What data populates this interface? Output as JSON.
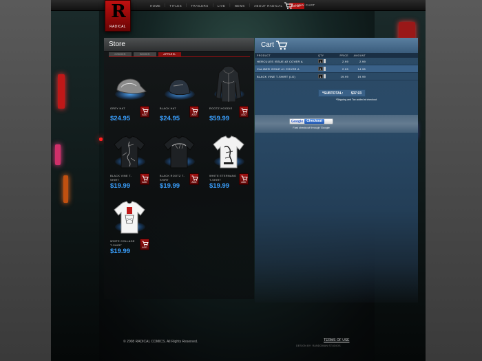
{
  "brand": {
    "logo_text": "RADICAL"
  },
  "nav": {
    "items": [
      "HOME",
      "TITLES",
      "TRAILERS",
      "LIVE",
      "NEWS",
      "ABOUT RADICAL"
    ],
    "active": "SHOP",
    "cart_link": "VIEW CART"
  },
  "store": {
    "title": "Store",
    "tabs": [
      "COMICS",
      "BOOKS",
      "APPAREL"
    ],
    "active_tab": "APPAREL",
    "products": [
      {
        "name": "GREY HAT",
        "price": "$24.95",
        "add_label": "ADD",
        "icon": "hat-icon"
      },
      {
        "name": "BLACK HAT",
        "price": "$24.95",
        "add_label": "ADD",
        "icon": "hat-icon"
      },
      {
        "name": "ROOTZ HOODIE",
        "price": "$59.99",
        "add_label": "ADD",
        "icon": "hoodie-icon"
      },
      {
        "name": "BLACK VINE T-SHIRT",
        "price": "$19.99",
        "add_label": "ADD",
        "icon": "tshirt-icon"
      },
      {
        "name": "BLACK ROOTZ T-SHIRT",
        "price": "$19.99",
        "add_label": "ADD",
        "icon": "tshirt-icon"
      },
      {
        "name": "WHITE ETERNANO T-SHIRT",
        "price": "$19.99",
        "add_label": "ADD",
        "icon": "tshirt-icon"
      },
      {
        "name": "WHITE COLLAGE T-SHIRT",
        "price": "$19.99",
        "add_label": "ADD",
        "icon": "tshirt-icon"
      }
    ]
  },
  "cart": {
    "title": "Cart",
    "columns": {
      "product": "PRODUCT",
      "qty": "QTY",
      "price": "PRICE",
      "amount": "AMOUNT"
    },
    "rows": [
      {
        "product": "HERCULES ISSUE #2 COVER A",
        "qty": "1",
        "price": "2.99",
        "amount": "2.99"
      },
      {
        "product": "CALIBER ISSUE #1 COVER A",
        "qty": "5",
        "price": "2.99",
        "amount": "14.95"
      },
      {
        "product": "BLACK VINE T-SHIRT (LG)",
        "qty": "1",
        "price": "19.99",
        "amount": "19.99"
      }
    ],
    "subtotal_label": "*SUBTOTAL:",
    "subtotal_value": "$37.93",
    "shipping_note": "*Shipping and Tax added at checkout.",
    "google_label": "Google",
    "checkout_label": "Checkout",
    "checkout_tagline": "Fast checkout through Google"
  },
  "footer": {
    "copyright": "© 2008 RADICAL COMICS. All Rights Reserved.",
    "terms": "TERMS OF USE",
    "credit": "DESIGN BY: RANDOMAN STUDIOS"
  },
  "colors": {
    "accent_red": "#a01212",
    "price_blue": "#3aa0ff",
    "cart_blue": "#2a4a67"
  }
}
